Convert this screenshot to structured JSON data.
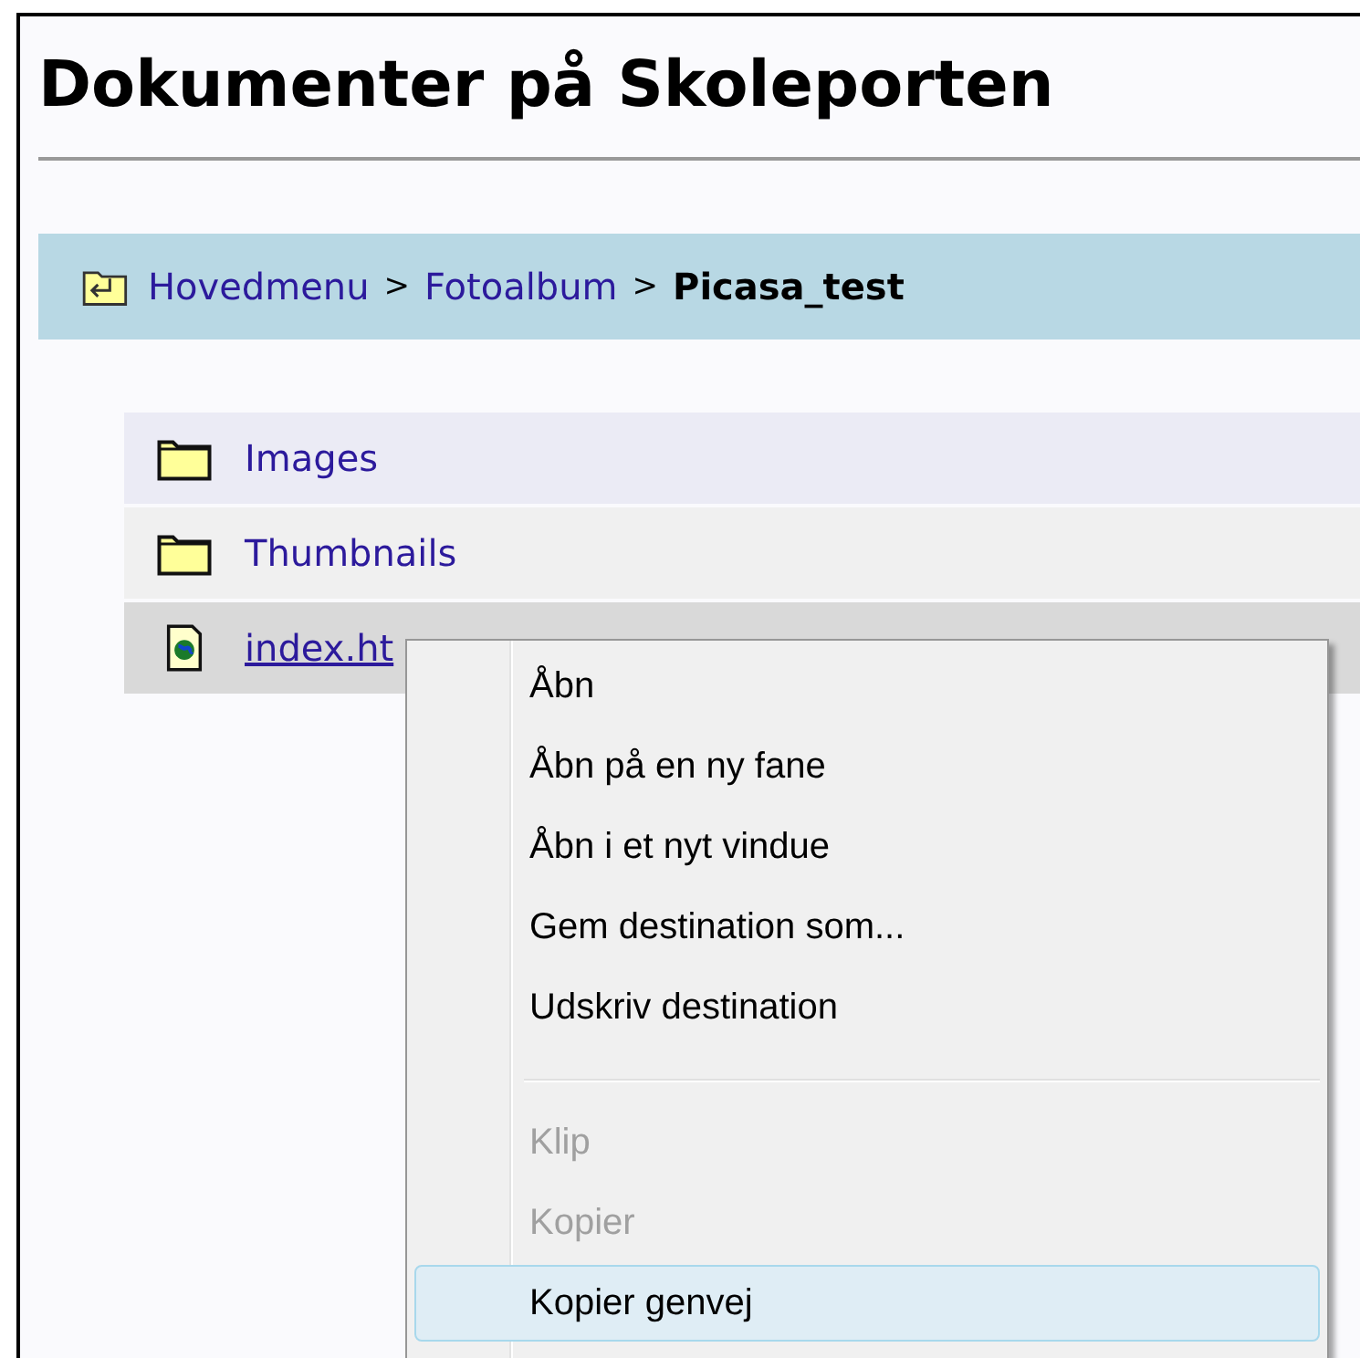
{
  "page": {
    "title": "Dokumenter på Skoleporten"
  },
  "breadcrumb": {
    "links": [
      "Hovedmenu",
      "Fotoalbum"
    ],
    "separators": [
      ">",
      ">"
    ],
    "current": "Picasa_test"
  },
  "files": [
    {
      "kind": "folder",
      "name": "Images",
      "selected": false
    },
    {
      "kind": "folder",
      "name": "Thumbnails",
      "selected": false
    },
    {
      "kind": "file",
      "name": "index.ht",
      "selected": true
    }
  ],
  "context_menu": {
    "items": [
      {
        "kind": "item",
        "label": "Åbn",
        "disabled": false,
        "selected": false
      },
      {
        "kind": "item",
        "label": "Åbn på en ny fane",
        "disabled": false,
        "selected": false
      },
      {
        "kind": "item",
        "label": "Åbn i et nyt vindue",
        "disabled": false,
        "selected": false
      },
      {
        "kind": "item",
        "label": "Gem destination som...",
        "disabled": false,
        "selected": false
      },
      {
        "kind": "item",
        "label": "Udskriv destination",
        "disabled": false,
        "selected": false
      },
      {
        "kind": "separator"
      },
      {
        "kind": "item",
        "label": "Klip",
        "disabled": true,
        "selected": false
      },
      {
        "kind": "item",
        "label": "Kopier",
        "disabled": true,
        "selected": false
      },
      {
        "kind": "item",
        "label": "Kopier genvej",
        "disabled": false,
        "selected": true
      }
    ]
  }
}
